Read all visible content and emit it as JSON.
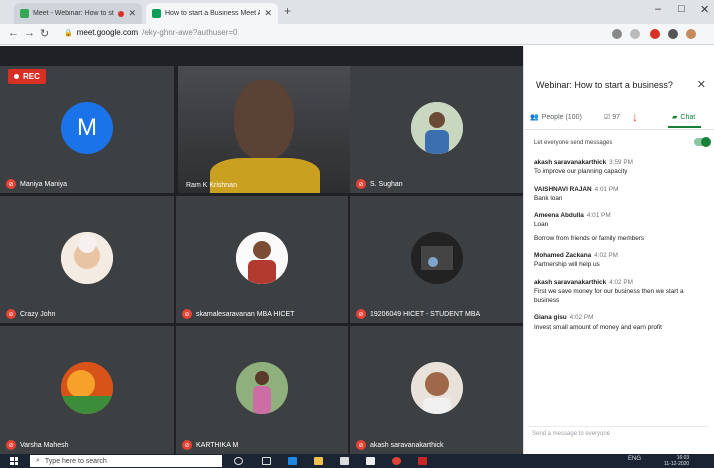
{
  "browser": {
    "tabs": [
      {
        "label": "Meet - Webinar: How to sta",
        "active": false
      },
      {
        "label": "How to start a Business Meet Att",
        "active": true
      }
    ],
    "new_tab": "+",
    "url_host": "meet.google.com",
    "url_path": "/eky-ghnr-awe?authuser=0",
    "window_controls": {
      "minimize": "–",
      "maximize": "□",
      "close": "✕"
    }
  },
  "meeting": {
    "recording_label": "REC",
    "tiles": [
      {
        "name": "Maniya Maniya",
        "avatar_letter": "M",
        "avatar_color": "#1a73e8"
      },
      {
        "name": "Ram K Krishnan",
        "type": "video"
      },
      {
        "name": "S. Sughan",
        "avatar_color": "#d7dde6"
      },
      {
        "name": "Crazy John",
        "avatar_color": "#f1e6da"
      },
      {
        "name": "skamalesaravanan MBA HICET",
        "avatar_color": "#f2f2f2"
      },
      {
        "name": "19206049 HICET - STUDENT MBA",
        "avatar_color": "#2b2b2b"
      },
      {
        "name": "Varsha Mahesh",
        "avatar_color": "#e0601f"
      },
      {
        "name": "KARTHIKA M",
        "avatar_color": "#6c8a5e"
      },
      {
        "name": "akash saravanakarthick",
        "avatar_color": "#d9d2c8"
      }
    ]
  },
  "panel": {
    "title": "Webinar: How to start a business?",
    "close": "✕",
    "people_tab": "People (100)",
    "badge_count": "97",
    "chat_tab": "Chat",
    "toggle_label": "Let everyone send messages",
    "messages": [
      {
        "sender": "akash saravanakarthick",
        "time": "3:59 PM",
        "lines": [
          "To improve our planning capacity"
        ]
      },
      {
        "sender": "VAISHNAVI RAJAN",
        "time": "4:01 PM",
        "lines": [
          "Bank loan"
        ]
      },
      {
        "sender": "Ameena Abdulla",
        "time": "4:01 PM",
        "lines": [
          "Loan",
          "Borrow from friends or family members"
        ]
      },
      {
        "sender": "Mohamed Zackana",
        "time": "4:02 PM",
        "lines": [
          "Partnership will help us"
        ]
      },
      {
        "sender": "akash saravanakarthick",
        "time": "4:02 PM",
        "lines": [
          "First we save money for our business then we start a business"
        ]
      },
      {
        "sender": "Giana gisu",
        "time": "4:02 PM",
        "lines": [
          "Invest small amount of money and earn profit"
        ]
      }
    ],
    "send_placeholder": "Send a message to everyone"
  },
  "taskbar": {
    "search_placeholder": "Type here to search",
    "tray_text": "ENG",
    "time": "16:03",
    "date": "11-12-2020"
  }
}
